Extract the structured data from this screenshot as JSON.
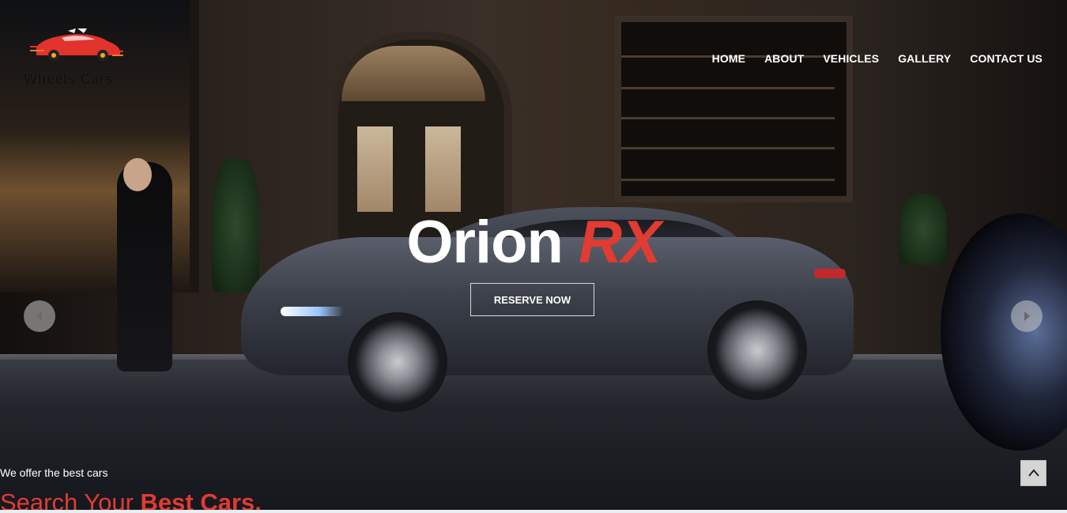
{
  "brand": {
    "name": "Wheels Cars",
    "logo_color": "#e2332d"
  },
  "nav": {
    "items": [
      "HOME",
      "ABOUT",
      "VEHICLES",
      "GALLERY",
      "CONTACT US"
    ]
  },
  "hero": {
    "title_main": "Orion",
    "title_accent": "RX",
    "cta_label": "RESERVE NOW",
    "prev_icon": "chevron-left-icon",
    "next_icon": "chevron-right-icon"
  },
  "section": {
    "tagline": "We offer the best cars",
    "heading_light": "Search Your ",
    "heading_bold": "Best Cars."
  },
  "scroll_top": {
    "icon": "chevron-up-icon"
  },
  "colors": {
    "accent": "#e13b32",
    "nav_text": "#ffffff"
  }
}
